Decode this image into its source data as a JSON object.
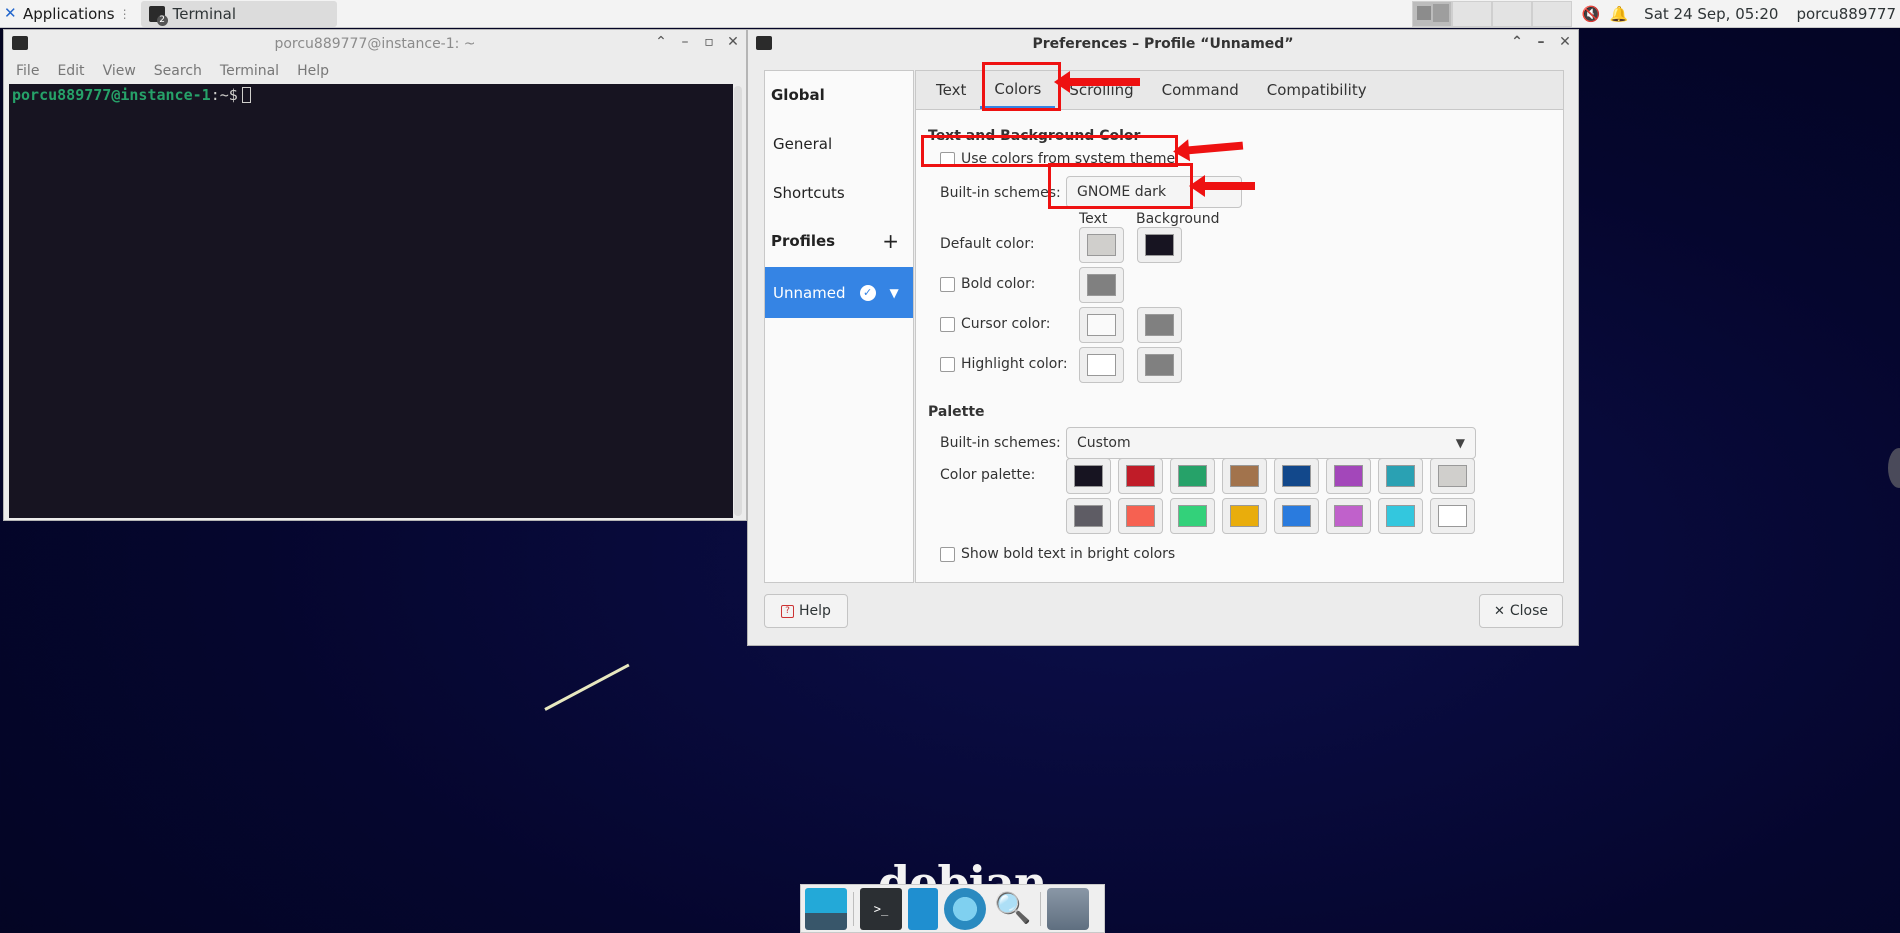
{
  "top_panel": {
    "applications_label": "Applications",
    "task_label": "Terminal",
    "datetime": "Sat 24 Sep, 05:20",
    "user": "porcu889777"
  },
  "terminal": {
    "title": "porcu889777@instance-1: ~",
    "menu": [
      "File",
      "Edit",
      "View",
      "Search",
      "Terminal",
      "Help"
    ],
    "prompt_user": "porcu889777@instance-1",
    "prompt_path": ":~$"
  },
  "preferences": {
    "title": "Preferences – Profile “Unnamed”",
    "sidebar": {
      "global_heading": "Global",
      "items": [
        "General",
        "Shortcuts"
      ],
      "profiles_heading": "Profiles",
      "profile_name": "Unnamed"
    },
    "tabs": [
      "Text",
      "Colors",
      "Scrolling",
      "Command",
      "Compatibility"
    ],
    "active_tab": "Colors",
    "text_bg": {
      "heading": "Text and Background Color",
      "use_system_theme": "Use colors from system theme",
      "builtin_label": "Built-in schemes:",
      "builtin_value": "GNOME dark",
      "col_text": "Text",
      "col_background": "Background",
      "default_label": "Default color:",
      "bold_label": "Bold color:",
      "cursor_label": "Cursor color:",
      "highlight_label": "Highlight color:"
    },
    "palette": {
      "heading": "Palette",
      "builtin_label": "Built-in schemes:",
      "builtin_value": "Custom",
      "palette_label": "Color palette:",
      "bright_bold": "Show bold text in bright colors",
      "row1": [
        "#171421",
        "#c01c28",
        "#26a269",
        "#a2734c",
        "#12488b",
        "#a347ba",
        "#2aa1b3",
        "#d0cfcc"
      ],
      "row2": [
        "#5e5c64",
        "#f66151",
        "#33d17a",
        "#e9ad0c",
        "#2a7bde",
        "#c061cb",
        "#33c7de",
        "#ffffff"
      ]
    },
    "swatches": {
      "default_text": "#d0cfcc",
      "default_bg": "#171421",
      "bold": "#808080",
      "cursor_text": "#fafafa",
      "cursor_bg": "#808080",
      "highlight_text": "#ffffff",
      "highlight_bg": "#808080"
    },
    "help_label": "Help",
    "close_label": "Close"
  },
  "desktop": {
    "logo_text": "debian"
  }
}
